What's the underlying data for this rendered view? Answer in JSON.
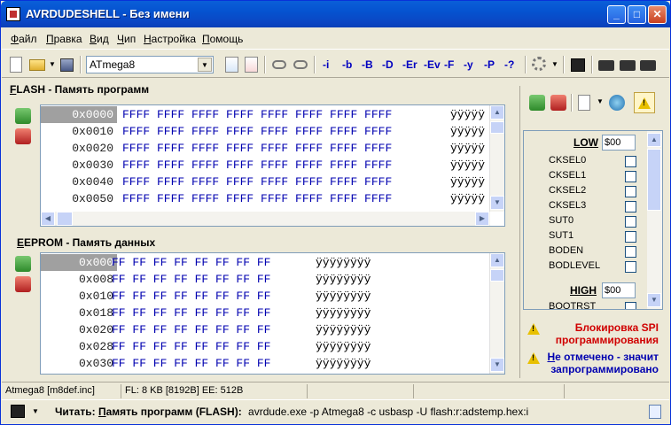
{
  "window": {
    "title": "AVRDUDESHELL - Без имени"
  },
  "menu": [
    "Файл",
    "Правка",
    "Вид",
    "Чип",
    "Настройка",
    "Помощь"
  ],
  "toolbar": {
    "device": "ATmega8",
    "options": [
      "-i",
      "-b",
      "-B",
      "-D",
      "-Er",
      "-Ev",
      "-F",
      "-y",
      "-P",
      "-?"
    ]
  },
  "flash": {
    "label_accel": "F",
    "label_rest": "LASH - Память программ",
    "rows": [
      {
        "addr": "0x0000",
        "bytes": "FFFF FFFF FFFF FFFF FFFF FFFF FFFF FFFF",
        "ascii": "ÿÿÿÿÿ"
      },
      {
        "addr": "0x0010",
        "bytes": "FFFF FFFF FFFF FFFF FFFF FFFF FFFF FFFF",
        "ascii": "ÿÿÿÿÿ"
      },
      {
        "addr": "0x0020",
        "bytes": "FFFF FFFF FFFF FFFF FFFF FFFF FFFF FFFF",
        "ascii": "ÿÿÿÿÿ"
      },
      {
        "addr": "0x0030",
        "bytes": "FFFF FFFF FFFF FFFF FFFF FFFF FFFF FFFF",
        "ascii": "ÿÿÿÿÿ"
      },
      {
        "addr": "0x0040",
        "bytes": "FFFF FFFF FFFF FFFF FFFF FFFF FFFF FFFF",
        "ascii": "ÿÿÿÿÿ"
      },
      {
        "addr": "0x0050",
        "bytes": "FFFF FFFF FFFF FFFF FFFF FFFF FFFF FFFF",
        "ascii": "ÿÿÿÿÿ"
      }
    ]
  },
  "eeprom": {
    "label_accel": "E",
    "label_rest": "EPROM - Память данных",
    "rows": [
      {
        "addr": "0x000",
        "bytes": "FF FF FF FF FF FF FF FF",
        "ascii": "ÿÿÿÿÿÿÿÿ"
      },
      {
        "addr": "0x008",
        "bytes": "FF FF FF FF FF FF FF FF",
        "ascii": "ÿÿÿÿÿÿÿÿ"
      },
      {
        "addr": "0x010",
        "bytes": "FF FF FF FF FF FF FF FF",
        "ascii": "ÿÿÿÿÿÿÿÿ"
      },
      {
        "addr": "0x018",
        "bytes": "FF FF FF FF FF FF FF FF",
        "ascii": "ÿÿÿÿÿÿÿÿ"
      },
      {
        "addr": "0x020",
        "bytes": "FF FF FF FF FF FF FF FF",
        "ascii": "ÿÿÿÿÿÿÿÿ"
      },
      {
        "addr": "0x028",
        "bytes": "FF FF FF FF FF FF FF FF",
        "ascii": "ÿÿÿÿÿÿÿÿ"
      },
      {
        "addr": "0x030",
        "bytes": "FF FF FF FF FF FF FF FF",
        "ascii": "ÿÿÿÿÿÿÿÿ"
      }
    ]
  },
  "fuses": {
    "low_label": "LOW",
    "low_value": "$00",
    "bits": [
      "CKSEL0",
      "CKSEL1",
      "CKSEL2",
      "CKSEL3",
      "SUT0",
      "SUT1",
      "BODEN",
      "BODLEVEL"
    ],
    "high_label": "HIGH",
    "high_value": "$00",
    "partial_bit": "BOOTRST"
  },
  "warnings": {
    "spi_line1": "Блокировка SPI",
    "spi_line2": "программирования",
    "note_accel": "Н",
    "note_line1": "е отмечено - значит",
    "note_line2": "запрограммировано"
  },
  "status": {
    "file": "Atmega8 [m8def.inc]",
    "memory": "FL: 8 KB [8192B]   EE: 512B"
  },
  "command": {
    "label": "Читать: ",
    "target_accel": "П",
    "target": "амять программ (FLASH):",
    "cmdline": "avrdude.exe -p Atmega8 -c usbasp -U flash:r:adstemp.hex:i"
  }
}
